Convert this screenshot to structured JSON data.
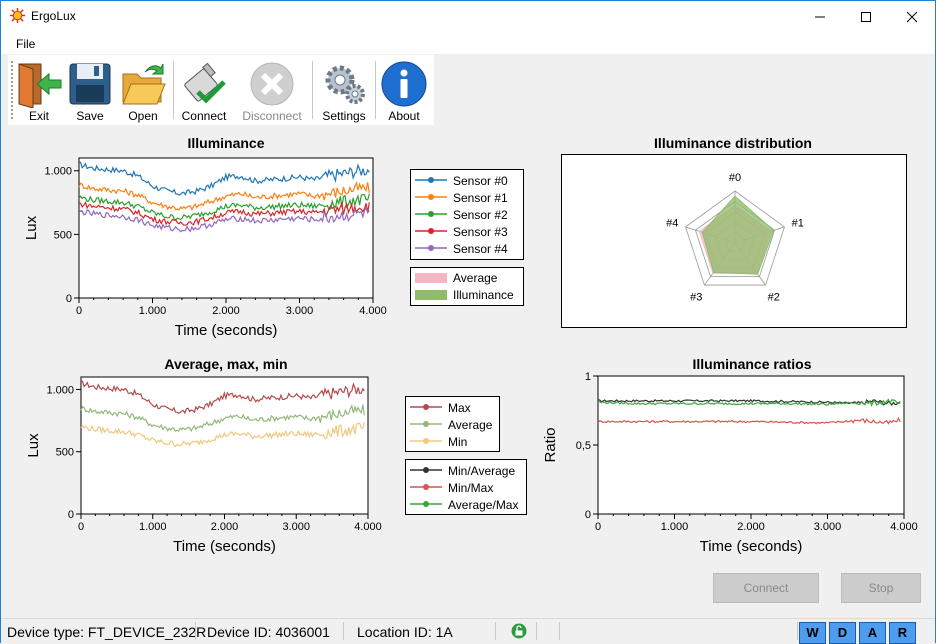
{
  "window": {
    "title": "ErgoLux"
  },
  "menu": {
    "file": "File"
  },
  "toolbar": {
    "exit": "Exit",
    "save": "Save",
    "open": "Open",
    "connect": "Connect",
    "disconnect": "Disconnect",
    "settings": "Settings",
    "about": "About"
  },
  "plots": {
    "illuminance": {
      "title": "Illuminance",
      "xlabel": "Time (seconds)",
      "ylabel": "Lux"
    },
    "distribution": {
      "title": "Illuminance distribution"
    },
    "avg": {
      "title": "Average, max, min",
      "xlabel": "Time (seconds)",
      "ylabel": "Lux"
    },
    "ratios": {
      "title": "Illuminance ratios",
      "xlabel": "Time (seconds)",
      "ylabel": "Ratio"
    }
  },
  "legends": {
    "sensors": [
      "Sensor #0",
      "Sensor #1",
      "Sensor #2",
      "Sensor #3",
      "Sensor #4"
    ],
    "radar": [
      "Average",
      "Illuminance"
    ],
    "stats": [
      "Max",
      "Average",
      "Min"
    ],
    "ratios": [
      "Min/Average",
      "Min/Max",
      "Average/Max"
    ]
  },
  "buttons": {
    "connect": "Connect",
    "stop": "Stop"
  },
  "status": {
    "device_type": "Device type: FT_DEVICE_232R",
    "device_id": "Device ID: 4036001",
    "location_id": "Location ID: 1A",
    "indicators": [
      "W",
      "D",
      "A",
      "R"
    ]
  },
  "colors": {
    "sensor0": "#1f77b4",
    "sensor1": "#ff7f0e",
    "sensor2": "#2ca02c",
    "sensor3": "#d62728",
    "sensor4": "#9467bd",
    "max": "#b54a4a",
    "average": "#93b87a",
    "min": "#f0c87e",
    "min_avg": "#333333",
    "min_max": "#d9534f",
    "avg_max": "#3aa63a",
    "radar_average": "#f4b6c2",
    "radar_illuminance": "#8fbc6a",
    "indicator": "#4d9cf0"
  },
  "chart_data": [
    {
      "type": "line",
      "title": "Illuminance",
      "xlabel": "Time (seconds)",
      "ylabel": "Lux",
      "xlim": [
        0,
        4000
      ],
      "ylim": [
        0,
        1100
      ],
      "xticks": [
        "0",
        "1.000",
        "2.000",
        "3.000",
        "4.000"
      ],
      "yticks": [
        "0",
        "500",
        "1.000"
      ],
      "x": [
        0,
        200,
        400,
        600,
        800,
        1000,
        1200,
        1400,
        1600,
        1800,
        2000,
        2200,
        2400,
        2600,
        2800,
        3000,
        3200,
        3400,
        3600,
        3800,
        3950
      ],
      "series": [
        {
          "name": "Sensor #0",
          "values": [
            1050,
            1020,
            1010,
            1000,
            960,
            880,
            840,
            820,
            840,
            880,
            950,
            960,
            920,
            930,
            940,
            950,
            930,
            960,
            980,
            1000,
            1010
          ]
        },
        {
          "name": "Sensor #1",
          "values": [
            890,
            860,
            850,
            840,
            810,
            750,
            720,
            700,
            720,
            760,
            800,
            820,
            790,
            800,
            810,
            820,
            800,
            820,
            840,
            860,
            860
          ]
        },
        {
          "name": "Sensor #2",
          "values": [
            790,
            770,
            760,
            750,
            720,
            670,
            640,
            630,
            650,
            680,
            720,
            730,
            710,
            715,
            725,
            730,
            720,
            740,
            755,
            770,
            770
          ]
        },
        {
          "name": "Sensor #3",
          "values": [
            740,
            720,
            710,
            700,
            670,
            620,
            600,
            590,
            600,
            630,
            670,
            680,
            660,
            665,
            675,
            680,
            670,
            690,
            700,
            720,
            720
          ]
        },
        {
          "name": "Sensor #4",
          "values": [
            680,
            660,
            650,
            640,
            615,
            570,
            550,
            540,
            550,
            580,
            615,
            625,
            605,
            610,
            620,
            625,
            615,
            630,
            645,
            660,
            670
          ]
        }
      ]
    },
    {
      "type": "radar",
      "title": "Illuminance distribution",
      "categories": [
        "#0",
        "#1",
        "#2",
        "#3",
        "#4"
      ],
      "series": [
        {
          "name": "Average",
          "values": [
            0.72,
            0.72,
            0.72,
            0.72,
            0.72
          ]
        },
        {
          "name": "Illuminance",
          "values": [
            0.9,
            0.78,
            0.74,
            0.7,
            0.66
          ]
        }
      ]
    },
    {
      "type": "line",
      "title": "Average, max, min",
      "xlabel": "Time (seconds)",
      "ylabel": "Lux",
      "xlim": [
        0,
        4000
      ],
      "ylim": [
        0,
        1100
      ],
      "xticks": [
        "0",
        "1.000",
        "2.000",
        "3.000",
        "4.000"
      ],
      "yticks": [
        "0",
        "500",
        "1.000"
      ],
      "x": [
        0,
        200,
        400,
        600,
        800,
        1000,
        1200,
        1400,
        1600,
        1800,
        2000,
        2200,
        2400,
        2600,
        2800,
        3000,
        3200,
        3400,
        3600,
        3800,
        3950
      ],
      "series": [
        {
          "name": "Max",
          "values": [
            1050,
            1020,
            1010,
            1000,
            960,
            880,
            840,
            820,
            840,
            880,
            950,
            960,
            920,
            930,
            940,
            950,
            930,
            960,
            980,
            1000,
            1010
          ]
        },
        {
          "name": "Average",
          "values": [
            850,
            825,
            815,
            805,
            775,
            715,
            690,
            675,
            690,
            725,
            770,
            785,
            755,
            765,
            775,
            780,
            765,
            785,
            805,
            825,
            830
          ]
        },
        {
          "name": "Min",
          "values": [
            700,
            680,
            670,
            660,
            635,
            590,
            570,
            560,
            570,
            600,
            635,
            645,
            625,
            630,
            640,
            645,
            635,
            650,
            665,
            680,
            690
          ]
        }
      ]
    },
    {
      "type": "line",
      "title": "Illuminance ratios",
      "xlabel": "Time (seconds)",
      "ylabel": "Ratio",
      "xlim": [
        0,
        4000
      ],
      "ylim": [
        0,
        1
      ],
      "xticks": [
        "0",
        "1.000",
        "2.000",
        "3.000",
        "4.000"
      ],
      "yticks": [
        "0",
        "0,5",
        "1"
      ],
      "x": [
        0,
        500,
        1000,
        1500,
        2000,
        2500,
        3000,
        3400,
        3600,
        3800,
        3950
      ],
      "series": [
        {
          "name": "Min/Average",
          "values": [
            0.82,
            0.82,
            0.82,
            0.82,
            0.82,
            0.815,
            0.81,
            0.8,
            0.82,
            0.8,
            0.81
          ]
        },
        {
          "name": "Min/Max",
          "values": [
            0.67,
            0.67,
            0.67,
            0.67,
            0.67,
            0.665,
            0.66,
            0.68,
            0.67,
            0.66,
            0.68
          ]
        },
        {
          "name": "Average/Max",
          "values": [
            0.81,
            0.8,
            0.8,
            0.8,
            0.8,
            0.8,
            0.795,
            0.81,
            0.8,
            0.82,
            0.8
          ]
        }
      ]
    }
  ]
}
